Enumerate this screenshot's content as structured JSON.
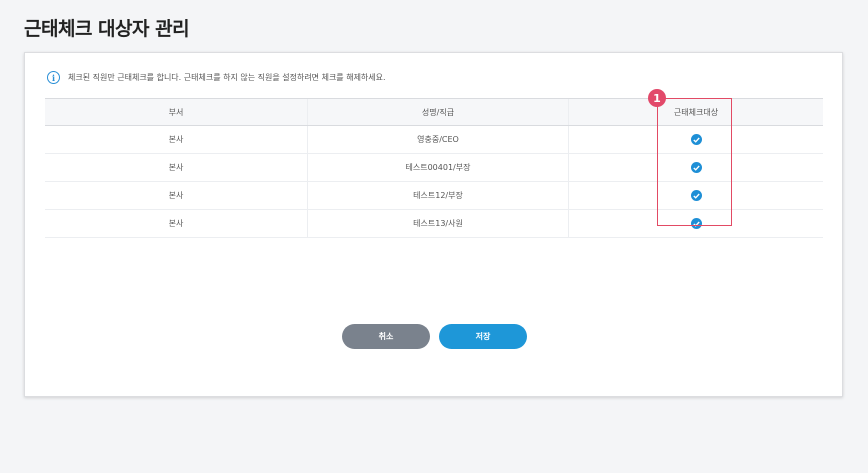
{
  "page": {
    "title": "근태체크 대상자 관리"
  },
  "notice": {
    "icon": "info-icon",
    "text": "체크된 직원만 근태체크를 합니다. 근태체크를 하지 않는 직원을 설정하려면 체크를 해제하세요."
  },
  "table": {
    "headers": [
      "부서",
      "성명/직급",
      "근태체크대상"
    ],
    "rows": [
      {
        "dept": "본사",
        "name": "영충중/CEO",
        "checked": true
      },
      {
        "dept": "본사",
        "name": "테스트00401/부장",
        "checked": true
      },
      {
        "dept": "본사",
        "name": "테스트12/부장",
        "checked": true
      },
      {
        "dept": "본사",
        "name": "테스트13/사원",
        "checked": true
      }
    ]
  },
  "annotation": {
    "marker": "1",
    "color": "#e2496a"
  },
  "buttons": {
    "cancel": "취소",
    "save": "저장"
  },
  "colors": {
    "accent": "#1e97d8",
    "cancel": "#7a828d"
  }
}
